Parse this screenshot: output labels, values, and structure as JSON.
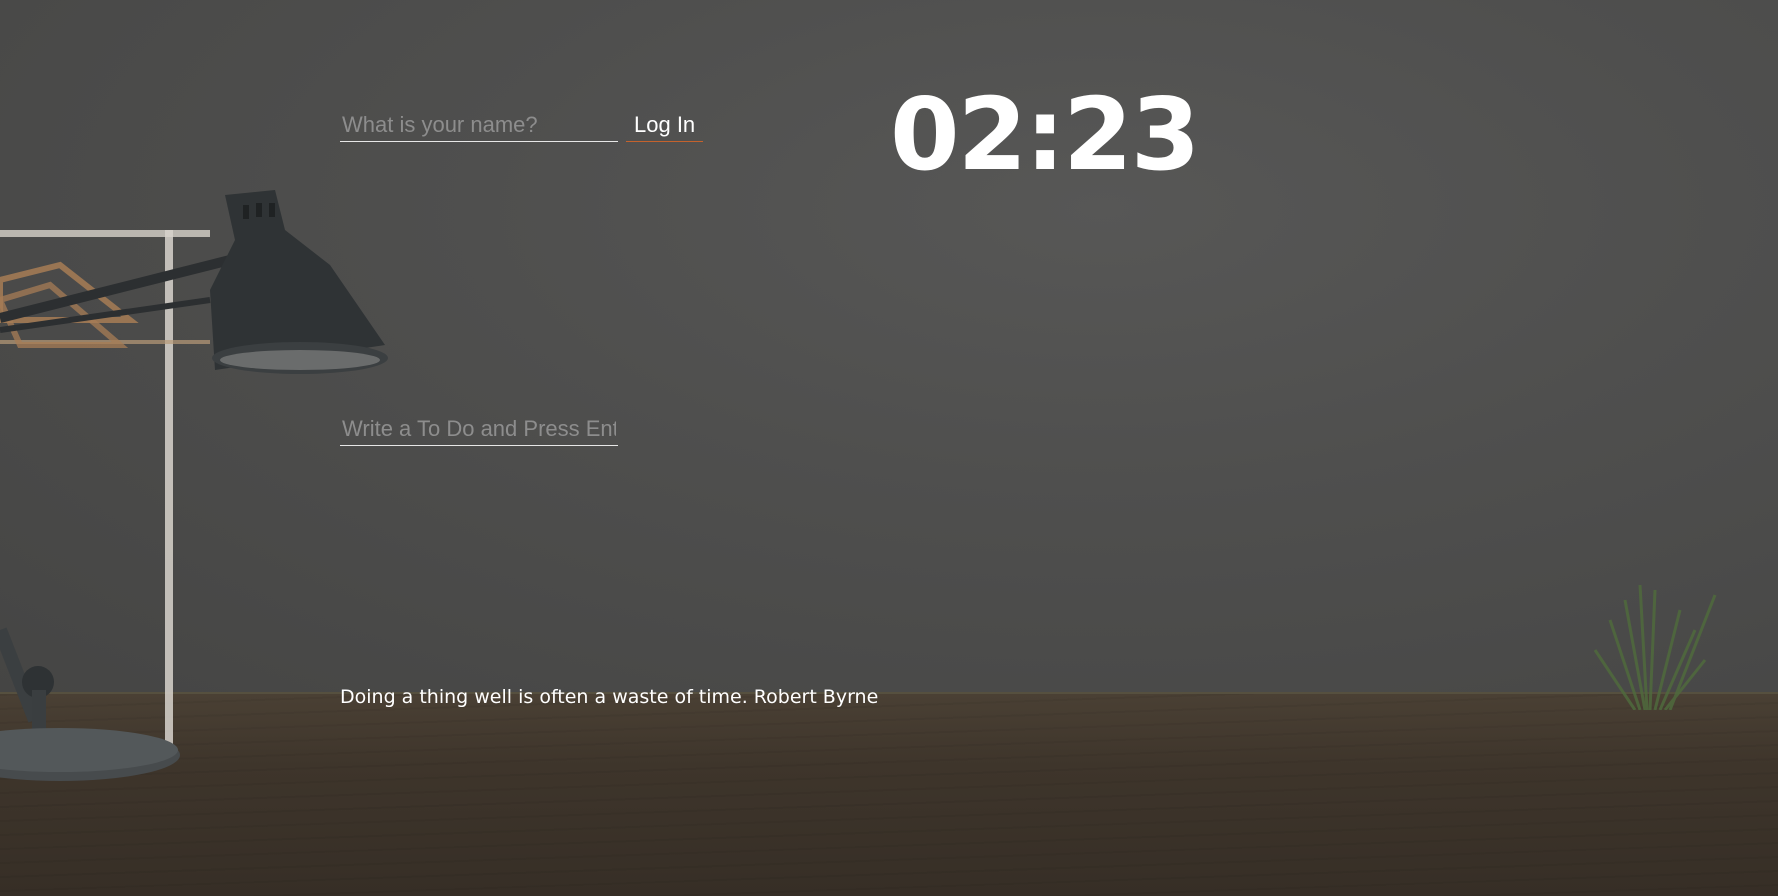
{
  "login": {
    "name_placeholder": "What is your name?",
    "login_label": "Log In"
  },
  "clock": {
    "time": "02:23"
  },
  "todo": {
    "placeholder": "Write a To Do and Press Enter"
  },
  "quote": {
    "text": "Doing a thing well is often a waste of time.",
    "author": "Robert Byrne"
  },
  "colors": {
    "accent": "#c4622d",
    "text": "#ffffff",
    "placeholder": "#8d8d8d"
  }
}
